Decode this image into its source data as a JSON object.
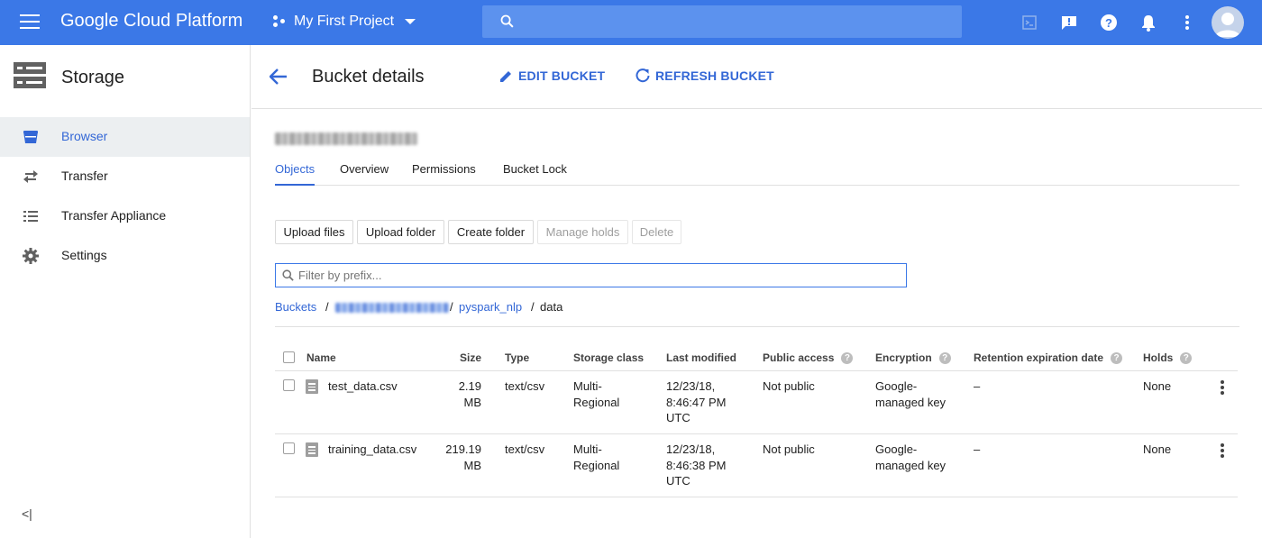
{
  "topbar": {
    "brand": "Google Cloud Platform",
    "project": "My First Project"
  },
  "nav": {
    "title": "Storage",
    "items": [
      {
        "label": "Browser",
        "icon": "bucket-icon"
      },
      {
        "label": "Transfer",
        "icon": "transfer-icon"
      },
      {
        "label": "Transfer Appliance",
        "icon": "transfer-appliance-icon"
      },
      {
        "label": "Settings",
        "icon": "gear-icon"
      }
    ],
    "collapse": "<|"
  },
  "header": {
    "title": "Bucket details",
    "edit": "EDIT BUCKET",
    "refresh": "REFRESH BUCKET"
  },
  "tabs": [
    "Objects",
    "Overview",
    "Permissions",
    "Bucket Lock"
  ],
  "actions": {
    "upload_files": "Upload files",
    "upload_folder": "Upload folder",
    "create_folder": "Create folder",
    "manage_holds": "Manage holds",
    "delete": "Delete"
  },
  "filter": {
    "placeholder": "Filter by prefix..."
  },
  "breadcrumb": {
    "root": "Buckets",
    "folder": "pyspark_nlp",
    "current": "data"
  },
  "table": {
    "headers": {
      "name": "Name",
      "size": "Size",
      "type": "Type",
      "storage_class": "Storage class",
      "last_modified": "Last modified",
      "public_access": "Public access",
      "encryption": "Encryption",
      "retention": "Retention expiration date",
      "holds": "Holds"
    },
    "rows": [
      {
        "name": "test_data.csv",
        "size_1": "2.19",
        "size_2": "MB",
        "type": "text/csv",
        "class_1": "Multi-",
        "class_2": "Regional",
        "mod_1": "12/23/18,",
        "mod_2": "8:46:47 PM",
        "mod_3": "UTC",
        "public": "Not public",
        "enc_1": "Google-",
        "enc_2": "managed key",
        "retention": "–",
        "holds": "None"
      },
      {
        "name": "training_data.csv",
        "size_1": "219.19",
        "size_2": "MB",
        "type": "text/csv",
        "class_1": "Multi-",
        "class_2": "Regional",
        "mod_1": "12/23/18,",
        "mod_2": "8:46:38 PM",
        "mod_3": "UTC",
        "public": "Not public",
        "enc_1": "Google-",
        "enc_2": "managed key",
        "retention": "–",
        "holds": "None"
      }
    ]
  },
  "colors": {
    "topbar": "#3b78e7",
    "accent": "#3367d6"
  }
}
